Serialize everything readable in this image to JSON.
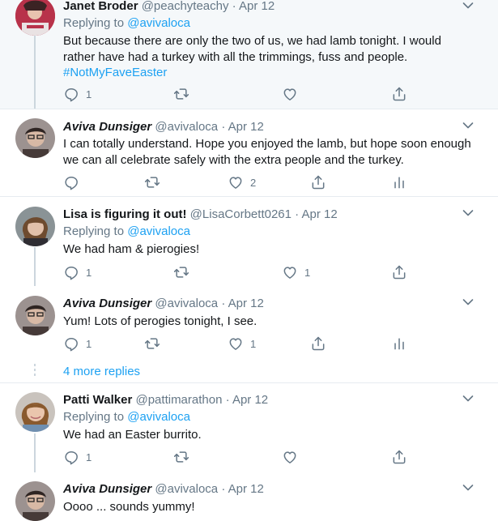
{
  "tweets": [
    {
      "name": "Janet Broder",
      "handle": "@peachyteachy",
      "date": "Apr 12",
      "reply_label": "Replying to",
      "reply_to": "@avivaloca",
      "text": "But because there are only the two of us, we had lamb tonight. I would rather have had a turkey with all the trimmings, fuss and people.",
      "hashtag": "#NotMyFaveEaster",
      "reply_count": "1",
      "like_count": ""
    },
    {
      "name": "Aviva Dunsiger",
      "handle": "@avivaloca",
      "date": "Apr 12",
      "text": "I can totally understand. Hope you enjoyed the lamb, but hope soon enough we can all celebrate safely with the extra people and the turkey.",
      "reply_count": "",
      "like_count": "2"
    },
    {
      "name": "Lisa is figuring it out!",
      "handle": "@LisaCorbett0261",
      "date": "Apr 12",
      "reply_label": "Replying to",
      "reply_to": "@avivaloca",
      "text": "We had ham & pierogies!",
      "reply_count": "1",
      "like_count": "1"
    },
    {
      "name": "Aviva Dunsiger",
      "handle": "@avivaloca",
      "date": "Apr 12",
      "text": "Yum! Lots of perogies tonight, I see.",
      "reply_count": "1",
      "like_count": "1"
    },
    {
      "name": "Patti Walker",
      "handle": "@pattimarathon",
      "date": "Apr 12",
      "reply_label": "Replying to",
      "reply_to": "@avivaloca",
      "text": "We had an Easter burrito.",
      "reply_count": "1",
      "like_count": ""
    },
    {
      "name": "Aviva Dunsiger",
      "handle": "@avivaloca",
      "date": "Apr 12",
      "text": "Oooo ... sounds yummy!"
    }
  ],
  "more_replies": "4 more replies",
  "separator": "·",
  "colors": {
    "accent": "#1da1f2",
    "muted": "#657786",
    "highlight_bg": "#f5f8fa",
    "border": "#e6ecf0"
  },
  "icons": [
    "reply-icon",
    "retweet-icon",
    "like-icon",
    "share-icon",
    "analytics-icon",
    "chevron-down-icon"
  ]
}
